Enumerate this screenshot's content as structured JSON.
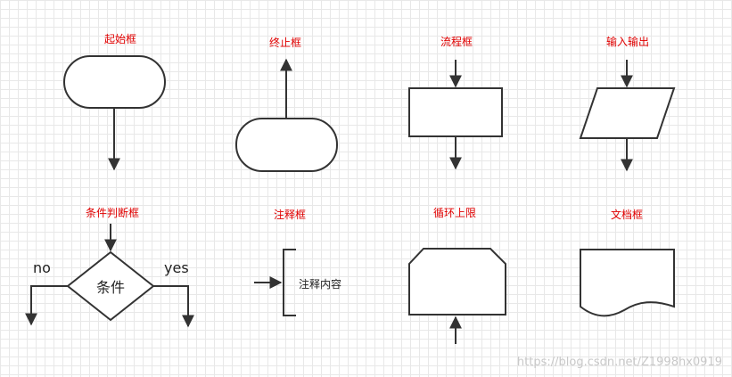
{
  "labels": {
    "start": "起始框",
    "end": "终止框",
    "process": "流程框",
    "io": "输入输出",
    "decision": "条件判断框",
    "comment": "注释框",
    "loop": "循环上限",
    "document": "文档框"
  },
  "decision": {
    "text": "条件",
    "no": "no",
    "yes": "yes"
  },
  "comment": {
    "text": "注释内容"
  },
  "watermark": "https://blog.csdn.net/Z1998hx0919",
  "colors": {
    "label": "#e00000",
    "stroke": "#333333",
    "grid": "#e8e8e8"
  }
}
